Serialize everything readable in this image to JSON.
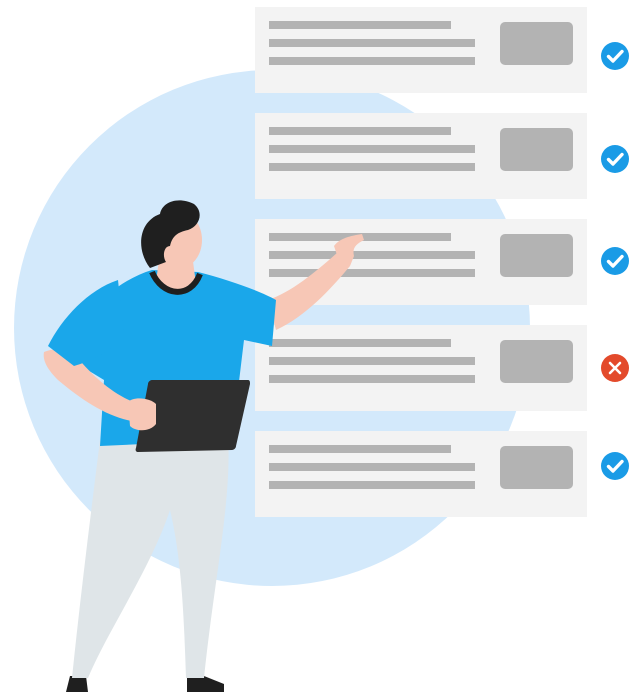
{
  "illustration": {
    "subject": "person-presenting-checklist",
    "colors": {
      "background_circle": "#d3e9fb",
      "card": "#f3f3f3",
      "placeholder": "#b3b3b3",
      "pass": "#1a9be6",
      "fail": "#e34a2b",
      "shirt": "#1aa7ea",
      "pants": "#dfe5e8",
      "skin": "#f7c7b6",
      "hair": "#1f1f1f",
      "tablet": "#2f2f2f"
    }
  },
  "checklist": {
    "items": [
      {
        "status": "pass",
        "icon": "check-circle-icon"
      },
      {
        "status": "pass",
        "icon": "check-circle-icon"
      },
      {
        "status": "pass",
        "icon": "check-circle-icon"
      },
      {
        "status": "fail",
        "icon": "x-circle-icon"
      },
      {
        "status": "pass",
        "icon": "check-circle-icon"
      }
    ]
  }
}
